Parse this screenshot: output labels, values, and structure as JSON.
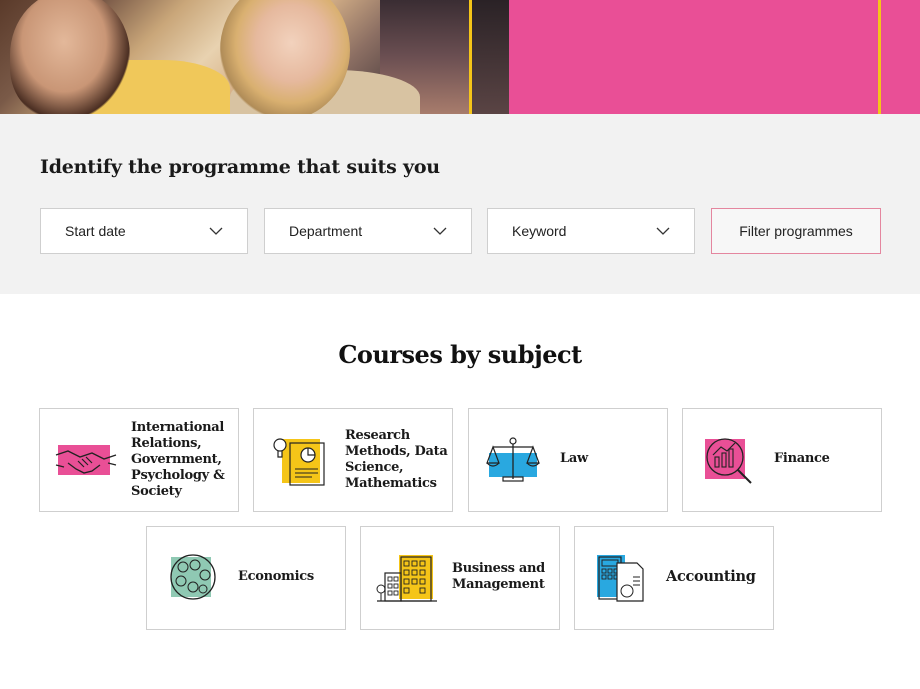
{
  "filter": {
    "title": "Identify the programme that suits you",
    "start_date": "Start date",
    "department": "Department",
    "keyword": "Keyword",
    "button": "Filter programmes"
  },
  "courses": {
    "title": "Courses by subject",
    "items": [
      {
        "label": "International Relations, Government, Psychology & Society",
        "icon": "handshake-icon"
      },
      {
        "label": "Research Methods, Data Science, Mathematics",
        "icon": "research-report-icon"
      },
      {
        "label": "Law",
        "icon": "scales-icon"
      },
      {
        "label": "Finance",
        "icon": "finance-chart-icon"
      },
      {
        "label": "Economics",
        "icon": "currency-globe-icon"
      },
      {
        "label": "Business and Management",
        "icon": "buildings-icon"
      },
      {
        "label": "Accounting",
        "icon": "calculator-icon"
      }
    ]
  },
  "colors": {
    "accent_pink": "#e94f96",
    "accent_yellow": "#f5c518",
    "accent_blue": "#29a8e0",
    "accent_green": "#8fc9b3"
  }
}
